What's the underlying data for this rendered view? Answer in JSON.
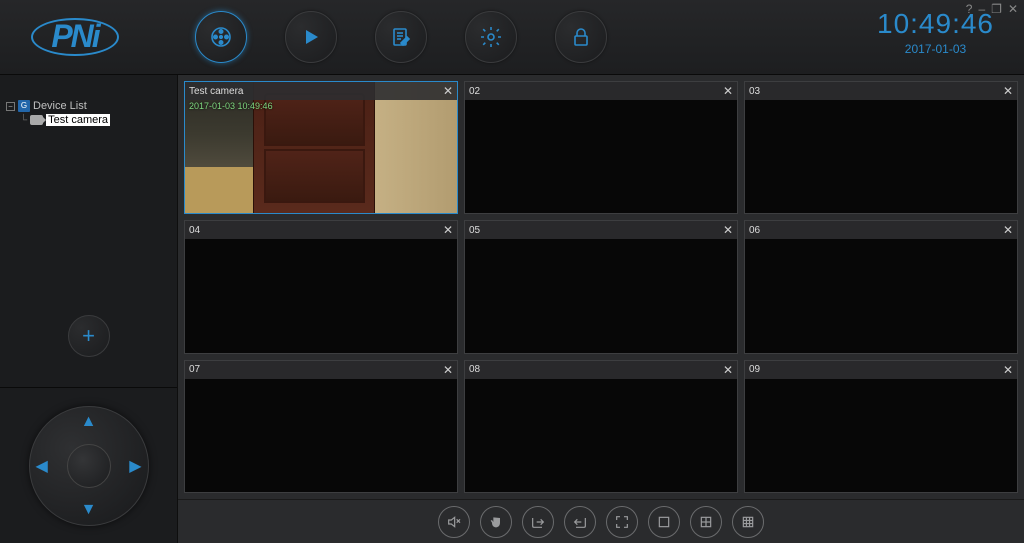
{
  "header": {
    "logo_text": "PNi",
    "time": "10:49:46",
    "date": "2017-01-03"
  },
  "window_controls": {
    "help": "?",
    "minimize": "–",
    "maximize": "❐",
    "close": "✕"
  },
  "sidebar": {
    "root_label": "Device List",
    "root_badge": "G",
    "expand_symbol": "−",
    "child_label": "Test camera",
    "add_symbol": "+"
  },
  "grid": {
    "cells": [
      {
        "label": "Test camera",
        "hasVideo": true,
        "selected": true,
        "timestamp": "2017-01-03 10:49:46"
      },
      {
        "label": "02",
        "hasVideo": false,
        "selected": false
      },
      {
        "label": "03",
        "hasVideo": false,
        "selected": false
      },
      {
        "label": "04",
        "hasVideo": false,
        "selected": false
      },
      {
        "label": "05",
        "hasVideo": false,
        "selected": false
      },
      {
        "label": "06",
        "hasVideo": false,
        "selected": false
      },
      {
        "label": "07",
        "hasVideo": false,
        "selected": false
      },
      {
        "label": "08",
        "hasVideo": false,
        "selected": false
      },
      {
        "label": "09",
        "hasVideo": false,
        "selected": false
      }
    ],
    "close_symbol": "✕"
  }
}
